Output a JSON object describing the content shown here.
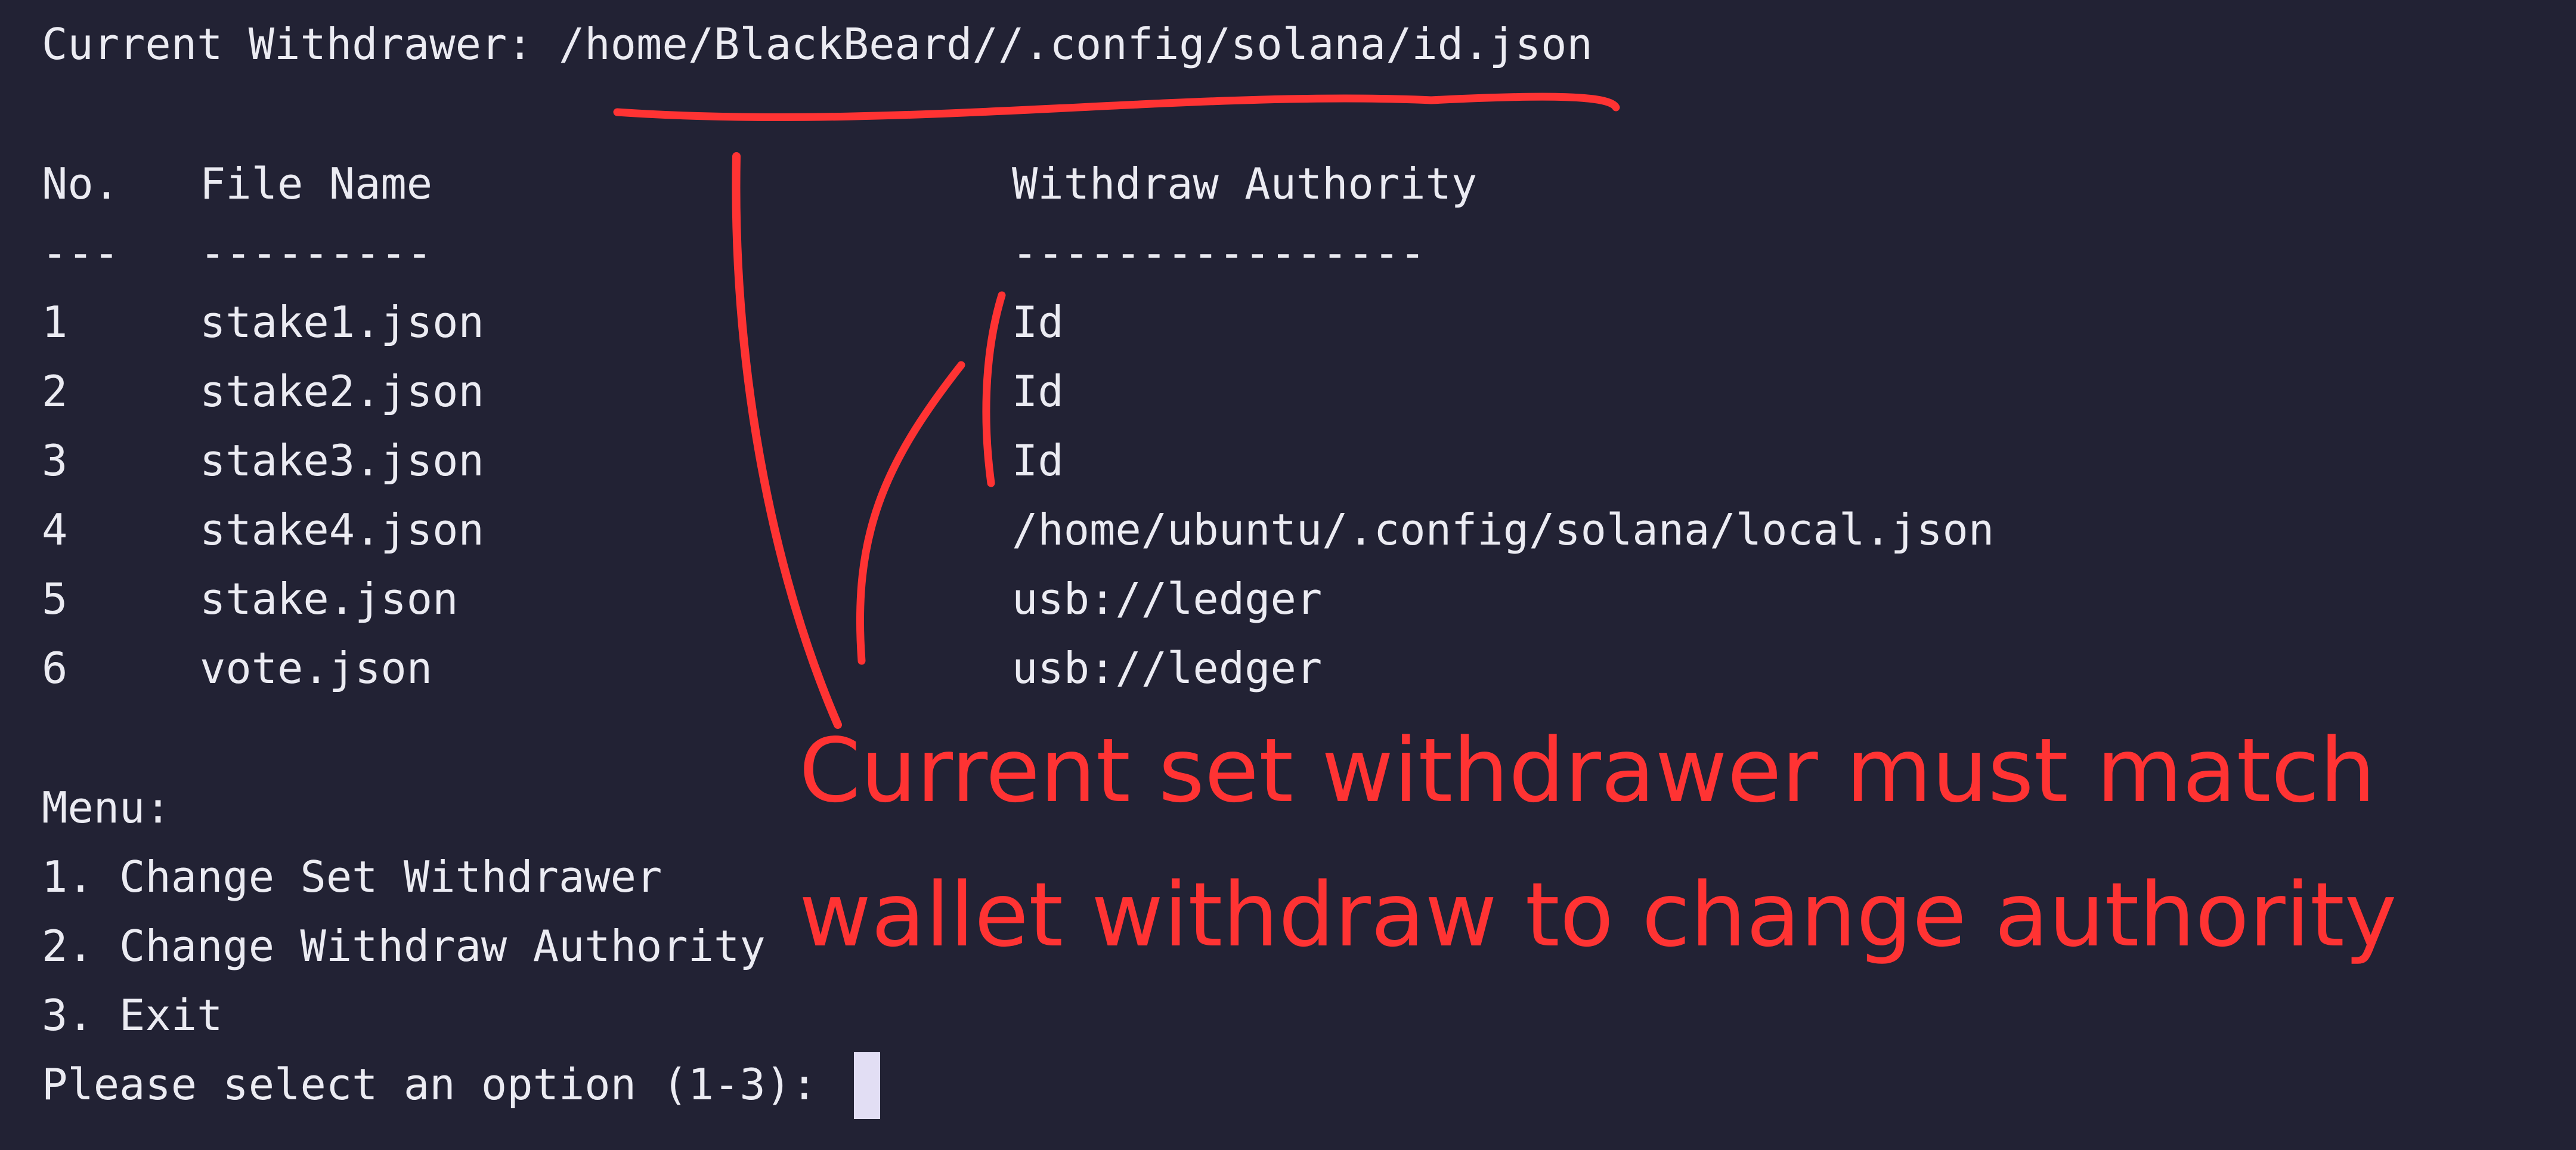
{
  "header": {
    "label": "Current Withdrawer: ",
    "path": "/home/BlackBeard//.config/solana/id.json"
  },
  "table": {
    "columns": [
      "No.",
      "File Name",
      "Withdraw Authority"
    ],
    "underlines": [
      "---",
      "---------",
      "----------------"
    ],
    "rows": [
      {
        "no": "1",
        "file": "stake1.json",
        "authority": "Id"
      },
      {
        "no": "2",
        "file": "stake2.json",
        "authority": "Id"
      },
      {
        "no": "3",
        "file": "stake3.json",
        "authority": "Id"
      },
      {
        "no": "4",
        "file": "stake4.json",
        "authority": "/home/ubuntu/.config/solana/local.json"
      },
      {
        "no": "5",
        "file": "stake.json",
        "authority": "usb://ledger"
      },
      {
        "no": "6",
        "file": "vote.json",
        "authority": "usb://ledger"
      }
    ]
  },
  "menu": {
    "title": "Menu:",
    "items": [
      "1. Change Set Withdrawer",
      "2. Change Withdraw Authority",
      "3. Exit"
    ],
    "prompt": "Please select an option (1-3): "
  },
  "annotation": {
    "line1": "Current set withdrawer must match",
    "line2": "wallet withdraw to change authority",
    "color": "#ff3333"
  },
  "colors": {
    "background": "#222234",
    "text": "#ebebf2",
    "cursor": "#e2def4"
  }
}
